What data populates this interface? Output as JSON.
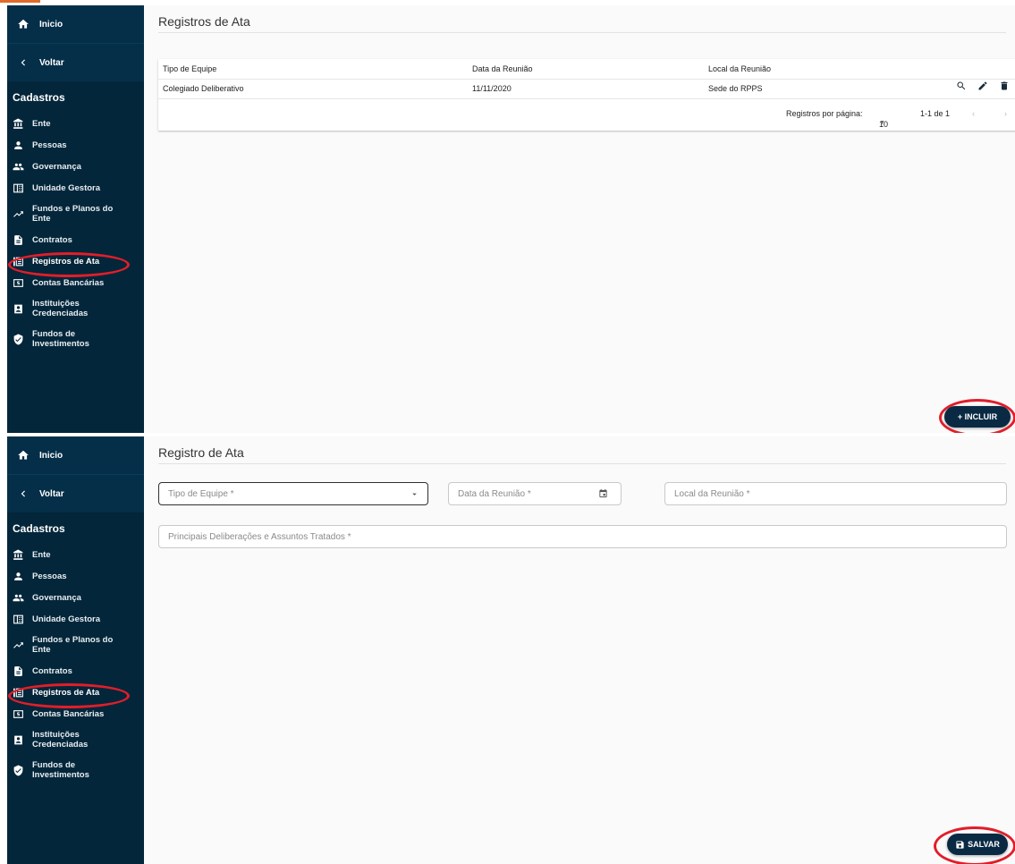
{
  "nav": {
    "home_label": "Inicio",
    "back_label": "Voltar",
    "section_title": "Cadastros",
    "items": [
      {
        "label": "Ente",
        "icon": "bank-icon"
      },
      {
        "label": "Pessoas",
        "icon": "person-icon"
      },
      {
        "label": "Governança",
        "icon": "people-icon"
      },
      {
        "label": "Unidade Gestora",
        "icon": "building-icon"
      },
      {
        "label_line1": "Fundos e Planos do",
        "label_line2": "Ente",
        "icon": "trending-up-icon"
      },
      {
        "label": "Contratos",
        "icon": "document-icon"
      },
      {
        "label": "Registros de Ata",
        "icon": "list-icon"
      },
      {
        "label": "Contas Bancárias",
        "icon": "money-icon"
      },
      {
        "label_line1": "Instituições",
        "label_line2": "Credenciadas",
        "icon": "badge-icon"
      },
      {
        "label_line1": "Fundos de",
        "label_line2": "Investimentos",
        "icon": "shield-icon"
      }
    ]
  },
  "list_page": {
    "title": "Registros de Ata",
    "columns": [
      "Tipo de Equipe",
      "Data da Reunião",
      "Local da Reunião"
    ],
    "rows": [
      {
        "tipo": "Colegiado Deliberativo",
        "data": "11/11/2020",
        "local": "Sede do RPPS"
      }
    ],
    "pagination": {
      "rows_per_page_label": "Registros por página:",
      "rows_per_page_value": "10",
      "range": "1-1 de 1"
    },
    "add_button_label": "+ INCLUIR"
  },
  "form_page": {
    "title": "Registro de Ata",
    "fields": {
      "tipo_equipe": "Tipo de Equipe *",
      "data_reuniao": "Data da Reunião *",
      "local_reuniao": "Local da Reunião *",
      "deliberacoes": "Principais Deliberações e Assuntos Tratados *"
    },
    "save_button_label": "SALVAR"
  },
  "colors": {
    "sidebar_bg": "#03263a",
    "accent_button": "#0a2a44",
    "annotation_ring": "#e01e2a"
  }
}
